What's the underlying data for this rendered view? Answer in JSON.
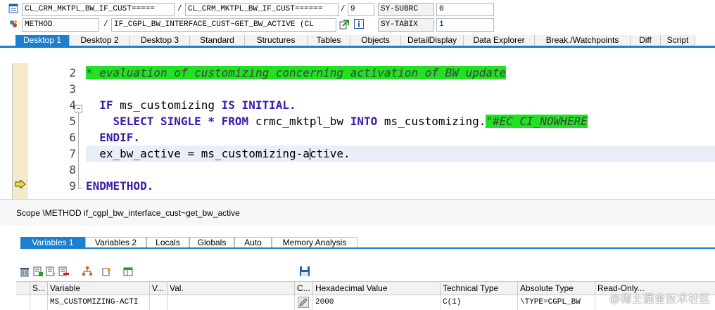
{
  "info": {
    "row1": {
      "field1": "CL_CRM_MKTPL_BW_IF_CUST=====",
      "sep1": "/",
      "field2": "CL_CRM_MKTPL_BW_IF_CUST======",
      "sep2": "/",
      "field3": "9",
      "label": "SY-SUBRC",
      "value": "0"
    },
    "row2": {
      "field1": "METHOD",
      "sep1": "/",
      "field2": "IF_CGPL_BW_INTERFACE_CUST~GET_BW_ACTIVE (CL",
      "label": "SY-TABIX",
      "value": "1"
    }
  },
  "desktop_tabs": [
    {
      "label": "Desktop 1",
      "active": true
    },
    {
      "label": "Desktop 2",
      "active": false
    },
    {
      "label": "Desktop 3",
      "active": false
    },
    {
      "label": "Standard",
      "active": false
    },
    {
      "label": "Structures",
      "active": false
    },
    {
      "label": "Tables",
      "active": false
    },
    {
      "label": "Objects",
      "active": false
    },
    {
      "label": "DetailDisplay",
      "active": false
    },
    {
      "label": "Data Explorer",
      "active": false
    },
    {
      "label": "Break./Watchpoints",
      "active": false
    },
    {
      "label": "Diff",
      "active": false
    },
    {
      "label": "Script",
      "active": false
    }
  ],
  "code": {
    "line_numbers": [
      "2",
      "3",
      "4",
      "5",
      "6",
      "7",
      "8",
      "9"
    ],
    "line2_comment": "* evaluation of customizing concerning activation of BW update",
    "line4_if": "IF",
    "line4_var": " ms_customizing ",
    "line4_is": "IS INITIAL.",
    "line5_select": "SELECT SINGLE * FROM",
    "line5_table": " crmc_mktpl_bw ",
    "line5_into": "INTO",
    "line5_target": " ms_customizing.",
    "line5_pragma": "\"#EC CI_NOWHERE",
    "line6_endif": "ENDIF.",
    "line7_part1": "ex_bw_active = ms_customizing-a",
    "line7_part2": "ctive.",
    "line9_endmethod": "ENDMETHOD."
  },
  "scope_text": "Scope \\METHOD if_cgpl_bw_interface_cust~get_bw_active",
  "variable_tabs": [
    {
      "label": "Variables 1",
      "active": true
    },
    {
      "label": "Variables 2",
      "active": false
    },
    {
      "label": "Locals",
      "active": false
    },
    {
      "label": "Globals",
      "active": false
    },
    {
      "label": "Auto",
      "active": false
    },
    {
      "label": "Memory Analysis",
      "active": false
    }
  ],
  "table": {
    "headers": {
      "s": "S...",
      "variable": "Variable",
      "v": "V...",
      "val": "Val.",
      "c": "C...",
      "hex": "Hexadecimal Value",
      "tech": "Technical Type",
      "abs": "Absolute Type",
      "readonly": "Read-Only..."
    },
    "row": {
      "variable": "MS_CUSTOMIZING-ACTI",
      "hex": "2000",
      "tech": "C(1)",
      "abs": "\\TYPE=CGPL_BW"
    }
  },
  "watermark": "@稀土掘金技术社区",
  "colors": {
    "accent": "#1c7fcf",
    "comment_bg": "#22e022",
    "keyword": "#3c1aa8",
    "gutter": "#f4e9c8"
  }
}
